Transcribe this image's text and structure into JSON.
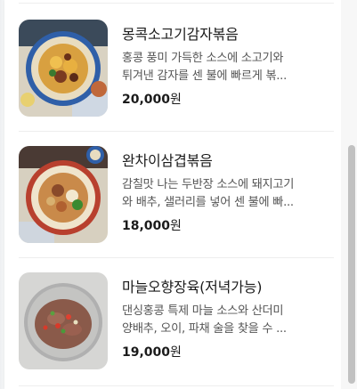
{
  "menu": {
    "items": [
      {
        "name": "몽콕소고기감자볶음",
        "desc_line1": "홍콩 풍미 가득한 소스에 소고기와",
        "desc_line2": "튀겨낸 감자를 센 불에 빠르게 볶...",
        "price": "20,000",
        "currency": "원"
      },
      {
        "name": "완차이삼겹볶음",
        "desc_line1": "감칠맛 나는 두반장 소스에 돼지고기",
        "desc_line2": "와 배추, 샐러리를 넣어 센 불에 빠...",
        "price": "18,000",
        "currency": "원"
      },
      {
        "name": "마늘오향장육(저녁가능)",
        "desc_line1": "댄싱홍콩 특제 마늘 소스와 산더미",
        "desc_line2": "양배추, 오이, 파채 술을 찾을 수 ...",
        "price": "19,000",
        "currency": "원"
      }
    ]
  },
  "colors": {
    "price_text": "#1b1b1b",
    "desc_text": "#555555",
    "divider": "#eeeeee"
  }
}
